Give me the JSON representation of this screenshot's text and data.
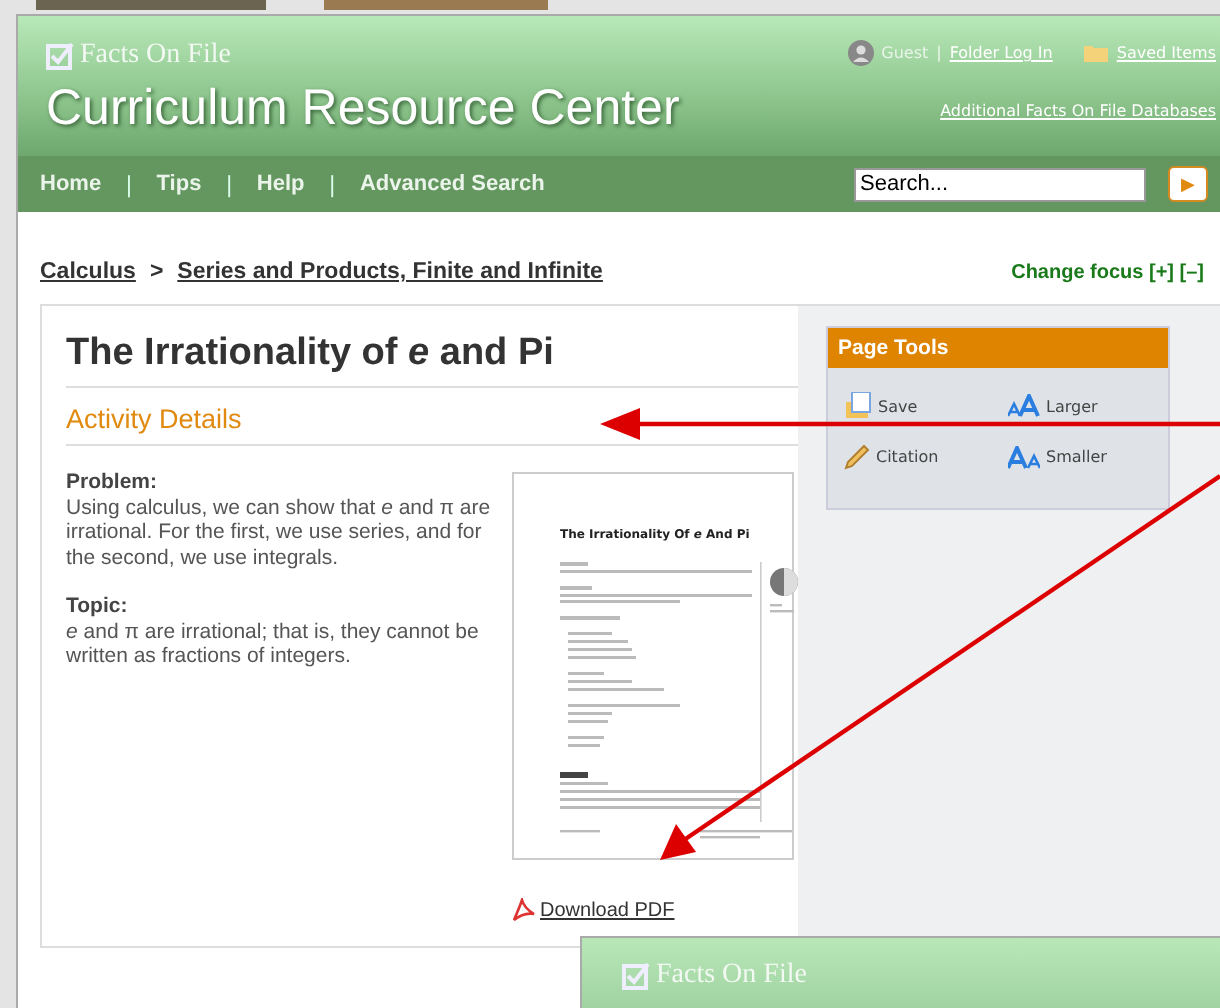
{
  "header": {
    "logo": "Facts On File",
    "title": "Curriculum Resource Center",
    "user": "Guest",
    "separator": "|",
    "login_link": "Folder Log In",
    "saved_link": "Saved Items",
    "databases_link": "Additional Facts On File Databases"
  },
  "nav": {
    "separator": "|",
    "items": [
      "Home",
      "Tips",
      "Help",
      "Advanced Search"
    ],
    "search": {
      "value": "Search..."
    },
    "go": "▶"
  },
  "breadcrumb": [
    "Calculus",
    "Series and Products, Finite and Infinite"
  ],
  "breadcrumb_separator": ">",
  "change_focus": "Change focus [+] [–]",
  "article": {
    "title": "The Irrationality of *e* and Pi",
    "section": "Activity Details",
    "fields": [
      {
        "label": "Problem:",
        "text": "Using calculus, we can show that *e* and π are irrational. For the first, we use series, and for the second, we use integrals."
      },
      {
        "label": "Topic:",
        "text": "*e* and π are irrational; that is, they cannot be written as fractions of integers."
      }
    ],
    "pdf_preview": {
      "title": "The Irrationality Of *e* And Pi"
    },
    "download": "Download PDF"
  },
  "page_tools": {
    "title": "Page Tools",
    "tools": [
      {
        "kind": "save",
        "label": "Save"
      },
      {
        "kind": "larger",
        "label": "Larger"
      },
      {
        "kind": "citation",
        "label": "Citation"
      },
      {
        "kind": "smaller",
        "label": "Smaller"
      }
    ]
  },
  "second_window": {
    "logo": "Facts On File"
  }
}
